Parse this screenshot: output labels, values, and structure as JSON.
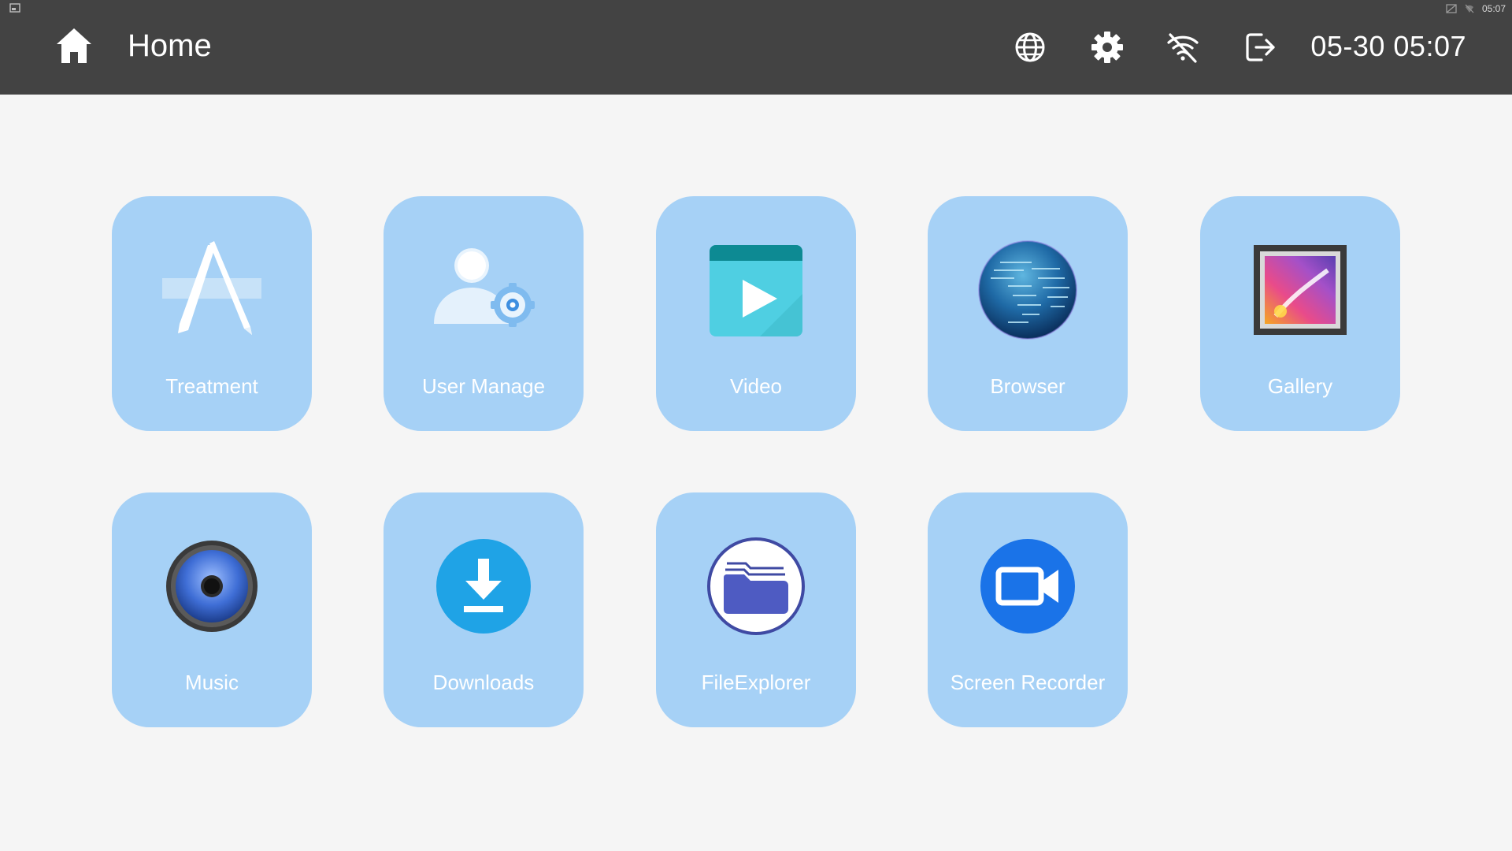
{
  "status_bar": {
    "time": "05:07"
  },
  "header": {
    "title": "Home",
    "datetime": "05-30 05:07"
  },
  "header_icons": [
    "home-icon",
    "globe-icon",
    "gear-icon",
    "wifi-off-icon",
    "logout-icon"
  ],
  "apps": [
    {
      "label": "Treatment",
      "icon": "app-store-icon"
    },
    {
      "label": "User Manage",
      "icon": "user-gear-icon"
    },
    {
      "label": "Video",
      "icon": "video-play-icon"
    },
    {
      "label": "Browser",
      "icon": "globe-browser-icon"
    },
    {
      "label": "Gallery",
      "icon": "gallery-picture-icon"
    },
    {
      "label": "Music",
      "icon": "speaker-icon"
    },
    {
      "label": "Downloads",
      "icon": "download-icon"
    },
    {
      "label": "FileExplorer",
      "icon": "folder-icon"
    },
    {
      "label": "Screen Recorder",
      "icon": "video-camera-icon"
    }
  ],
  "colors": {
    "header_bg": "#434343",
    "page_bg": "#f5f5f5",
    "tile_bg": "#a6d1f6",
    "tile_text": "#ffffff"
  }
}
